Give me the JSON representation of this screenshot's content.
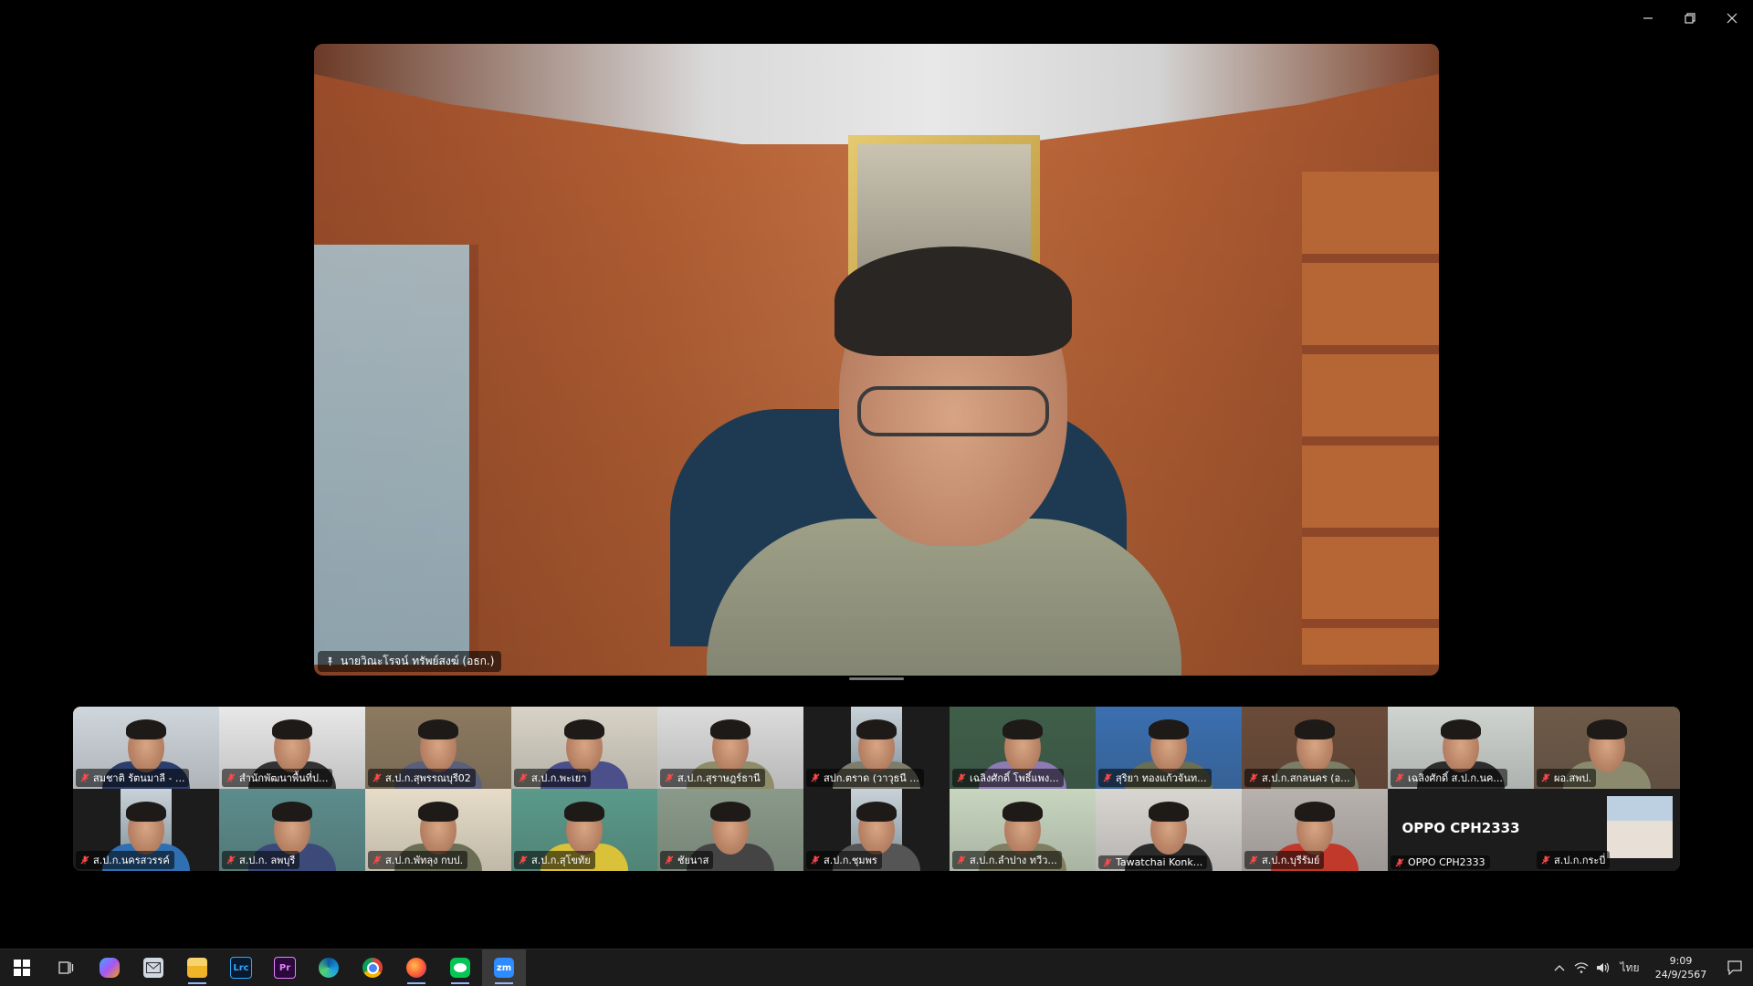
{
  "main_speaker": {
    "name": "นายวิณะโรจน์ ทรัพย์สงฆ์ (อธก.)"
  },
  "participants": [
    {
      "name": "สมชาติ รัตนมาลี - ...",
      "bg": "#cfd6dc",
      "shirt": "#2c3e6b"
    },
    {
      "name": "สำนักพัฒนาพื้นที่ป...",
      "bg": "#e8e8e8",
      "shirt": "#333333"
    },
    {
      "name": "ส.ป.ก.สุพรรณบุรี02",
      "bg": "#8c7a60",
      "shirt": "#5a5f7a"
    },
    {
      "name": "ส.ป.ก.พะเยา",
      "bg": "#d8d3c6",
      "shirt": "#4b4f8a"
    },
    {
      "name": "ส.ป.ก.สุราษฎร์ธานี",
      "bg": "#dcdcdc",
      "shirt": "#8f8c6a"
    },
    {
      "name": "สปก.ตราด (วาวุธนี ...",
      "bg": "#1c1c1c",
      "shirt": "#7d7d6b"
    },
    {
      "name": "เฉลิงศักดิ์ โพธิ์แพง...",
      "bg": "#3f5f4a",
      "shirt": "#8e7bb3"
    },
    {
      "name": "สุริยา ทองแก้วจันท...",
      "bg": "#3a6fb0",
      "shirt": "#6a6e55"
    },
    {
      "name": "ส.ป.ก.สกลนคร (อ...",
      "bg": "#6b4b38",
      "shirt": "#7c7d66"
    },
    {
      "name": "เฉลิงศักดิ์ ส.ป.ก.นค...",
      "bg": "#cfd4d0",
      "shirt": "#2d2d2d"
    },
    {
      "name": "ผอ.สพป.",
      "bg": "#6e5a48",
      "shirt": "#8b8a6e"
    },
    {
      "name": "ส.ป.ก.นครสวรรค์",
      "bg": "#1c1c1c",
      "shirt": "#2f6fb2"
    },
    {
      "name": "ส.ป.ก. ลพบุรี",
      "bg": "#5c8c8c",
      "shirt": "#3c4a7a"
    },
    {
      "name": "ส.ป.ก.พัทลุง กบป.",
      "bg": "#e6dcc8",
      "shirt": "#6b6e55"
    },
    {
      "name": "ส.ป.ก.สุโขทัย",
      "bg": "#5a9a8a",
      "shirt": "#d9c23a"
    },
    {
      "name": "ชัยนาส",
      "bg": "#8a9a8a",
      "shirt": "#444444"
    },
    {
      "name": "ส.ป.ก.ชุมพร",
      "bg": "#1c1c1c",
      "shirt": "#555555"
    },
    {
      "name": "ส.ป.ก.ลำปาง ทวีว...",
      "bg": "#c8d6c0",
      "shirt": "#7f7e63"
    },
    {
      "name": "Tawatchai Konk...",
      "bg": "#d9d6d2",
      "shirt": "#2b2b2b"
    },
    {
      "name": "ส.ป.ก.บุรีรัมย์",
      "bg": "#b8b2ae",
      "shirt": "#c0392b"
    },
    {
      "name": "OPPO CPH2333",
      "bg": "#1c1c1c",
      "shirt": "",
      "display": "OPPO CPH2333"
    },
    {
      "name": "ส.ป.ก.กระบี่",
      "bg": "#1c1c1c",
      "shirt": ""
    }
  ],
  "window_controls": {
    "minimize": "minimize",
    "restore": "restore",
    "close": "close"
  },
  "taskbar": {
    "apps": [
      {
        "name": "start-icon"
      },
      {
        "name": "task-view-icon"
      },
      {
        "name": "copilot-icon"
      },
      {
        "name": "mail-icon"
      },
      {
        "name": "file-explorer-icon"
      },
      {
        "name": "lightroom-icon",
        "label": "Lrc"
      },
      {
        "name": "premiere-icon",
        "label": "Pr"
      },
      {
        "name": "edge-icon"
      },
      {
        "name": "chrome-icon"
      },
      {
        "name": "firefox-icon"
      },
      {
        "name": "line-icon"
      },
      {
        "name": "zoom-icon",
        "label": "zm"
      }
    ],
    "language": "ไทย",
    "time": "9:09",
    "date": "24/9/2567"
  },
  "colors": {
    "zoom_blue": "#2d8cff",
    "mute_red": "#e02828"
  }
}
